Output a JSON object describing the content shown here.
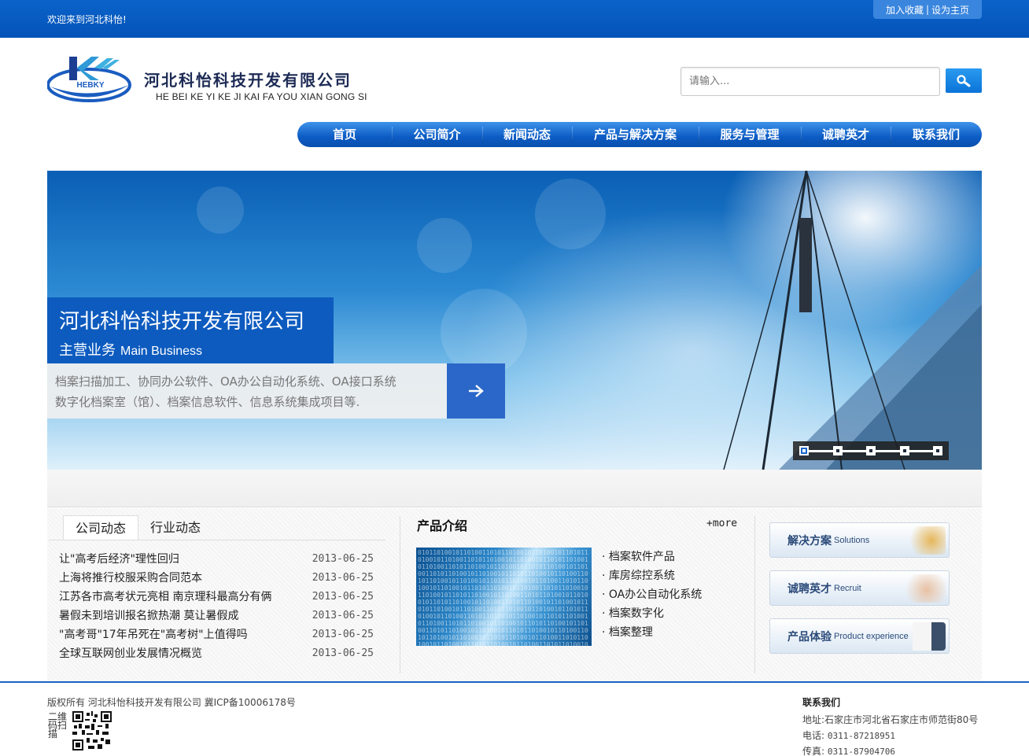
{
  "topbar": {
    "welcome": "欢迎来到河北科怡!",
    "bookmark": "加入收藏",
    "separator": "|",
    "homepage": "设为主页"
  },
  "header": {
    "logo_text": "HEBKY",
    "company_cn": "河北科怡科技开发有限公司",
    "company_en": "HE BEI KE YI KE JI  KAI FA YOU XIAN GONG SI"
  },
  "search": {
    "placeholder": "请输入..."
  },
  "nav": {
    "items": [
      "首页",
      "公司简介",
      "新闻动态",
      "产品与解决方案",
      "服务与管理",
      "诚聘英才",
      "联系我们"
    ]
  },
  "banner": {
    "title": "河北科怡科技开发有限公司",
    "subtitle_cn": "主营业务",
    "subtitle_en": "Main Business",
    "desc_line1": "档案扫描加工、协同办公软件、OA办公自动化系统、OA接口系统",
    "desc_line2": "数字化档案室（馆）、档案信息软件、信息系统集成项目等.",
    "slide_count": 5,
    "active_slide": 1
  },
  "news": {
    "tabs": [
      "公司动态",
      "行业动态"
    ],
    "active_tab": 0,
    "items": [
      {
        "title": "让\"高考后经济\"理性回归",
        "date": "2013-06-25"
      },
      {
        "title": "上海将推行校服采购合同范本",
        "date": "2013-06-25"
      },
      {
        "title": "江苏各市高考状元亮相 南京理科最高分有俩",
        "date": "2013-06-25"
      },
      {
        "title": "暑假未到培训报名掀热潮 莫让暑假成",
        "date": "2013-06-25"
      },
      {
        "title": "\"高考哥\"17年吊死在\"高考树\"上值得吗",
        "date": "2013-06-25"
      },
      {
        "title": "全球互联网创业发展情况概览",
        "date": "2013-06-25"
      }
    ]
  },
  "products": {
    "title": "产品介绍",
    "more": "+more",
    "bullet": "·",
    "items": [
      "档案软件产品",
      "库房综控系统",
      "OA办公自动化系统",
      "档案数字化",
      "档案整理"
    ]
  },
  "side": {
    "buttons": [
      {
        "cn": "解决方案",
        "en": "Solutions"
      },
      {
        "cn": "诚聘英才",
        "en": "Recruit"
      },
      {
        "cn": "产品体验",
        "en": "Product experience"
      }
    ]
  },
  "footer": {
    "copyright": "版权所有 河北科怡科技开发有限公司 冀ICP备10006178号",
    "qr_label": "二维码扫描",
    "contact_title": "联系我们",
    "address_label": "地址:",
    "address": "石家庄市河北省石家庄市师范街80号",
    "phone_label": "电话:",
    "phone": "0311-87218951",
    "fax_label": "传真:",
    "fax": "0311-87904706"
  },
  "colors": {
    "brand_blue": "#0a63c9",
    "nav_blue": "#0c5bc4",
    "banner_box": "#0d5bbf"
  }
}
